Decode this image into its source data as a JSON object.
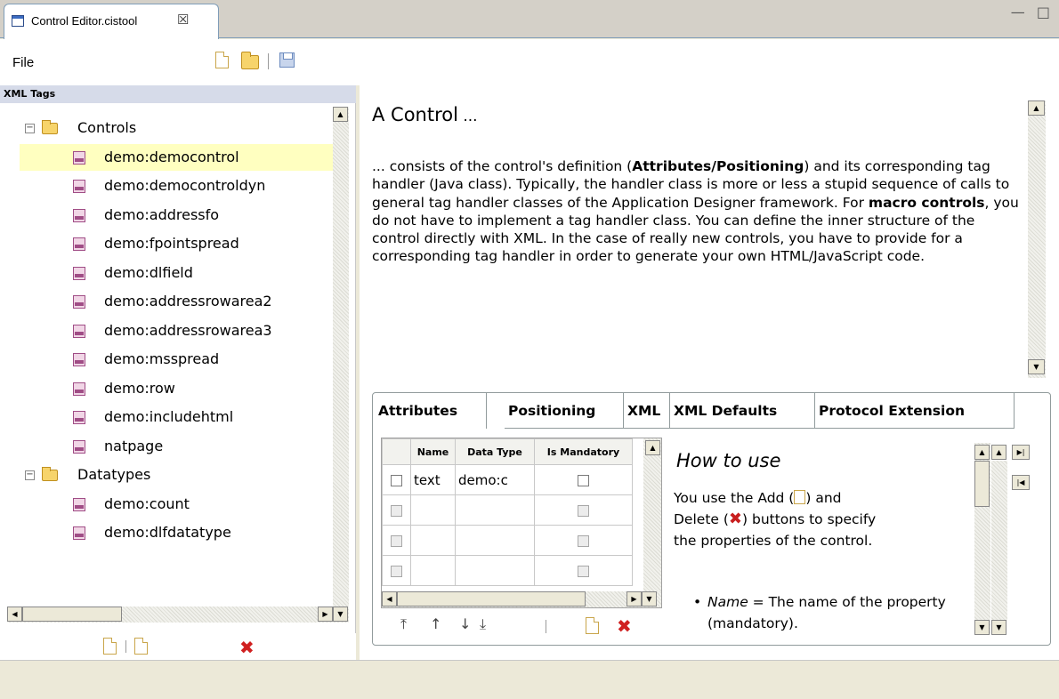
{
  "editor_tab": {
    "title": "Control Editor.cistool",
    "close": "☒"
  },
  "window_buttons": "— □",
  "toolbar": {
    "file_menu": "File"
  },
  "left_panel": {
    "header": "XML Tags",
    "tree": [
      {
        "label": "Controls",
        "type": "folder"
      },
      {
        "label": "demo:democontrol",
        "type": "tag",
        "selected": true
      },
      {
        "label": "demo:democontroldyn",
        "type": "tag"
      },
      {
        "label": "demo:addressfo",
        "type": "tag"
      },
      {
        "label": "demo:fpointspread",
        "type": "tag"
      },
      {
        "label": "demo:dlfield",
        "type": "tag"
      },
      {
        "label": "demo:addressrowarea2",
        "type": "tag"
      },
      {
        "label": "demo:addressrowarea3",
        "type": "tag"
      },
      {
        "label": "demo:msspread",
        "type": "tag"
      },
      {
        "label": "demo:row",
        "type": "tag"
      },
      {
        "label": "demo:includehtml",
        "type": "tag"
      },
      {
        "label": "natpage",
        "type": "tag"
      },
      {
        "label": "Datatypes",
        "type": "folder"
      },
      {
        "label": "demo:count",
        "type": "tag"
      },
      {
        "label": "demo:dlfdatatype",
        "type": "tag"
      }
    ]
  },
  "main": {
    "heading": "A Control",
    "heading_suffix": " ...",
    "desc_1": "... consists of the control's definition (",
    "desc_bold_1": "Attributes/Positioning",
    "desc_2": ") and its corresponding tag handler (Java class). Typically, the handler class is more or less a stupid sequence of calls to general tag handler classes of the Application Designer framework. For ",
    "desc_bold_2": "macro controls",
    "desc_3": ", you do not have to implement a tag handler class. You can define the inner structure of the control directly with XML. In the case of really new controls, you have to provide for a corresponding tag handler in order to generate your own HTML/JavaScript code."
  },
  "tabs": [
    "Attributes",
    "Positioning",
    "XML",
    "XML Defaults",
    "Protocol Extension"
  ],
  "attributes_table": {
    "columns": [
      "Name",
      "Data Type",
      "Is Mandatory"
    ],
    "rows": [
      {
        "name": "text",
        "data_type": "demo:c"
      },
      {
        "name": "",
        "data_type": ""
      },
      {
        "name": "",
        "data_type": ""
      },
      {
        "name": "",
        "data_type": ""
      }
    ]
  },
  "howto": {
    "title": "How to use",
    "line_1a": "You use the Add (",
    "line_1b": ") and",
    "line_2a": "Delete (",
    "line_2b": ") buttons to specify",
    "line_3": "the properties of the control.",
    "bullet_term": "Name",
    "bullet_text": " = The name of the property (mandatory)."
  }
}
